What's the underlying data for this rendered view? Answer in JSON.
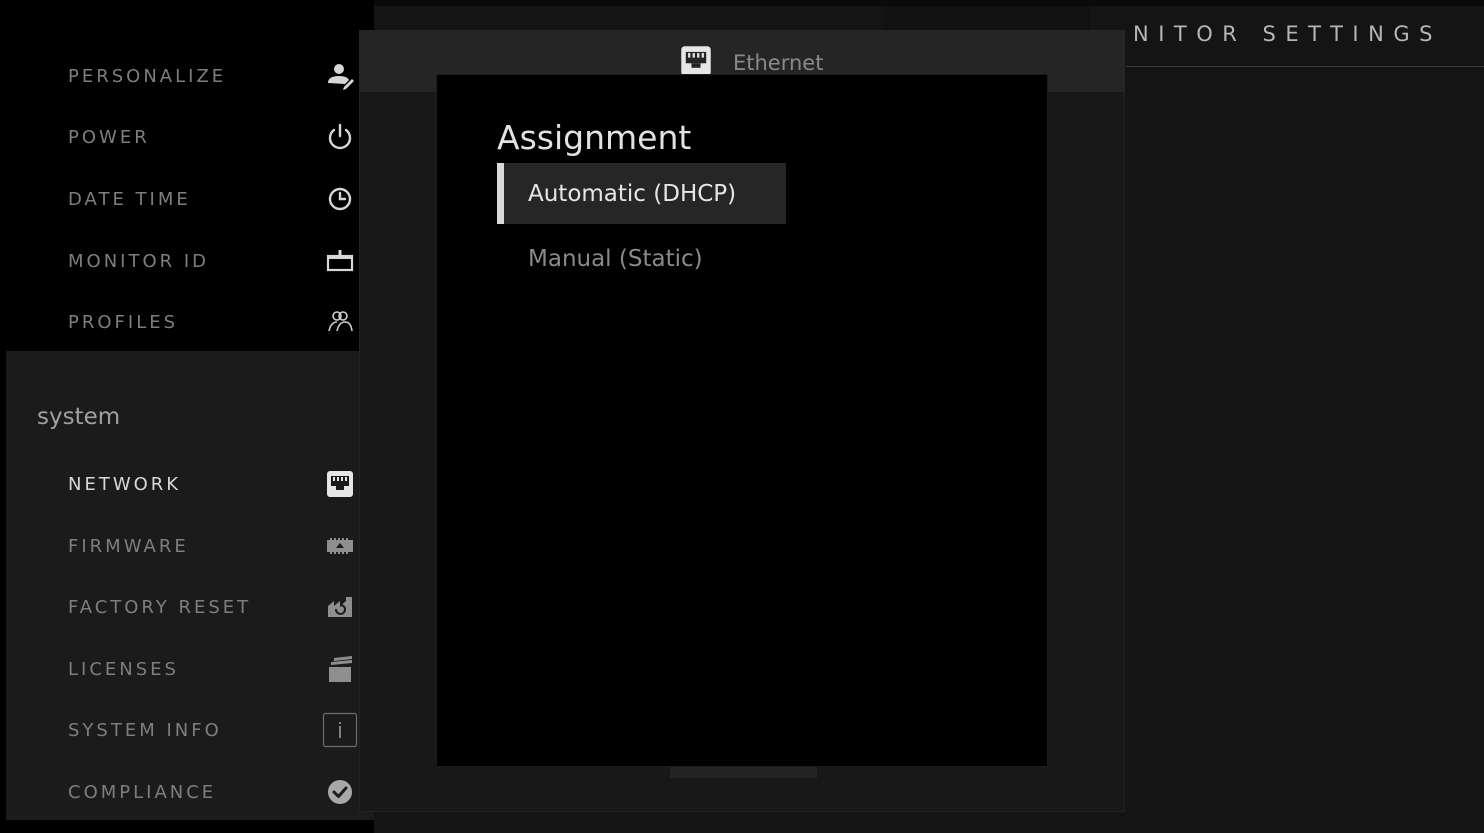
{
  "header": {
    "title": "NITOR SETTINGS"
  },
  "sidebar": {
    "items_top": [
      {
        "label": "PERSONALIZE",
        "icon": "person-edit-icon"
      },
      {
        "label": "POWER",
        "icon": "power-icon"
      },
      {
        "label": "DATE TIME",
        "icon": "clock-icon"
      },
      {
        "label": "MONITOR ID",
        "icon": "monitor-id-icon"
      },
      {
        "label": "PROFILES",
        "icon": "profiles-icon"
      }
    ],
    "section_title": "system",
    "items_system": [
      {
        "label": "NETWORK",
        "icon": "ethernet-icon",
        "active": true
      },
      {
        "label": "FIRMWARE",
        "icon": "firmware-icon"
      },
      {
        "label": "FACTORY RESET",
        "icon": "factory-reset-icon"
      },
      {
        "label": "LICENSES",
        "icon": "licenses-icon"
      },
      {
        "label": "SYSTEM INFO",
        "icon": "info-icon"
      },
      {
        "label": "COMPLIANCE",
        "icon": "check-circle-icon"
      }
    ]
  },
  "dialog": {
    "title": "Ethernet",
    "icon": "ethernet-icon",
    "heading": "Assignment",
    "options": [
      {
        "label": "Automatic (DHCP)",
        "selected": true
      },
      {
        "label": "Manual (Static)",
        "selected": false
      }
    ]
  },
  "colors": {
    "active_text": "#d8d8d8",
    "inactive_text": "#7e7e7e",
    "selection_bar": "#d9d9d9"
  }
}
